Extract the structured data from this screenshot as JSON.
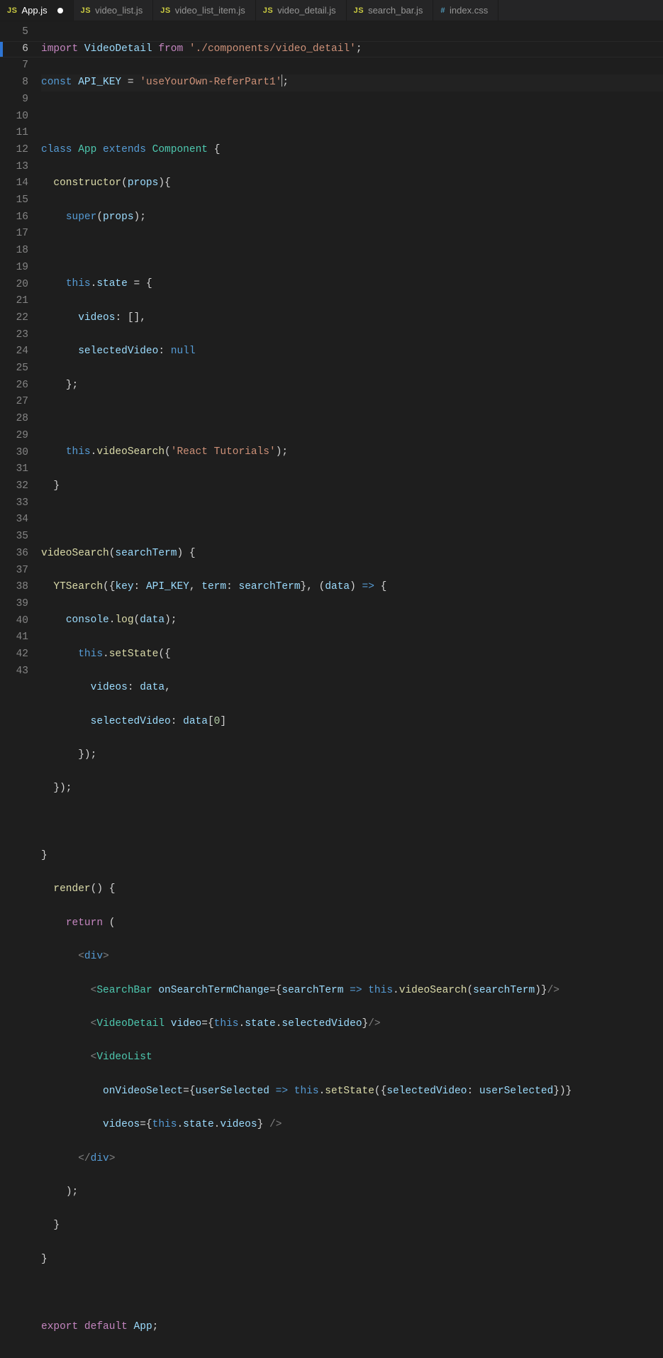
{
  "tabs": [
    {
      "icon": "JS",
      "label": "App.js",
      "active": true,
      "dirty": true
    },
    {
      "icon": "JS",
      "label": "video_list.js",
      "active": false,
      "dirty": false
    },
    {
      "icon": "JS",
      "label": "video_list_item.js",
      "active": false,
      "dirty": false
    },
    {
      "icon": "JS",
      "label": "video_detail.js",
      "active": false,
      "dirty": false
    },
    {
      "icon": "JS",
      "label": "search_bar.js",
      "active": false,
      "dirty": false
    },
    {
      "icon": "#",
      "label": "index.css",
      "active": false,
      "dirty": false,
      "css": true
    }
  ],
  "first_line_number": 5,
  "last_line_number": 43,
  "current_line_number": 6,
  "code_lines": {
    "l5": {
      "kw1": "import",
      "id": "VideoDetail",
      "kw2": "from",
      "str": "'./components/video_detail'",
      "tail": ";"
    },
    "l6": {
      "kw": "const",
      "id": "API_KEY",
      "op": "=",
      "str": "'useYourOwn-ReferPart1'",
      "tail": ";"
    },
    "l8": {
      "kw1": "class",
      "cls": "App",
      "kw2": "extends",
      "sup": "Component",
      "brace": "{"
    },
    "l9": {
      "fn": "constructor",
      "args": "props",
      "brace": "{"
    },
    "l10": {
      "kw": "super",
      "args": "props",
      "tail": ";"
    },
    "l12": {
      "kw": "this",
      "prop": "state",
      "op": "= {"
    },
    "l13": {
      "key": "videos",
      "val": "[]",
      "tail": ","
    },
    "l14": {
      "key": "selectedVideo",
      "val": "null"
    },
    "l15": {
      "close": "};"
    },
    "l17": {
      "kw": "this",
      "fn": "videoSearch",
      "str": "'React Tutorials'",
      "tail": ";"
    },
    "l18": {
      "close": "}"
    },
    "l20": {
      "fn": "videoSearch",
      "args": "searchTerm",
      "brace": "{"
    },
    "l21": {
      "fn": "YTSearch",
      "k1": "key",
      "v1": "API_KEY",
      "k2": "term",
      "v2": "searchTerm",
      "arg": "data",
      "arrow": "=>",
      "brace": "{"
    },
    "l22": {
      "obj": "console",
      "fn": "log",
      "arg": "data",
      "tail": ";"
    },
    "l23": {
      "kw": "this",
      "fn": "setState",
      "brace": "({"
    },
    "l24": {
      "key": "videos",
      "val": "data",
      "tail": ","
    },
    "l25": {
      "key": "selectedVideo",
      "val": "data",
      "idx": "0",
      "close": "]"
    },
    "l26": {
      "close": "});"
    },
    "l27": {
      "close": "});"
    },
    "l29": {
      "close": "}"
    },
    "l30": {
      "fn": "render",
      "brace": "{"
    },
    "l31": {
      "kw": "return",
      "open": "("
    },
    "l32": {
      "open": "<",
      "tag": "div",
      "close": ">"
    },
    "l33": {
      "tag": "SearchBar",
      "attr": "onSearchTermChange",
      "p": "searchTerm",
      "kw": "this",
      "fn": "videoSearch",
      "arg": "searchTerm"
    },
    "l34": {
      "tag": "VideoDetail",
      "attr": "video",
      "kw": "this",
      "p1": "state",
      "p2": "selectedVideo"
    },
    "l35": {
      "tag": "VideoList"
    },
    "l36": {
      "attr": "onVideoSelect",
      "p": "userSelected",
      "kw": "this",
      "fn": "setState",
      "key": "selectedVideo",
      "val": "userSelected"
    },
    "l37": {
      "attr": "videos",
      "kw": "this",
      "p1": "state",
      "p2": "videos"
    },
    "l38": {
      "open": "</",
      "tag": "div",
      "close": ">"
    },
    "l39": {
      "close": ");"
    },
    "l40": {
      "close": "}"
    },
    "l41": {
      "close": "}"
    },
    "l43": {
      "kw1": "export",
      "kw2": "default",
      "id": "App",
      "tail": ";"
    }
  }
}
